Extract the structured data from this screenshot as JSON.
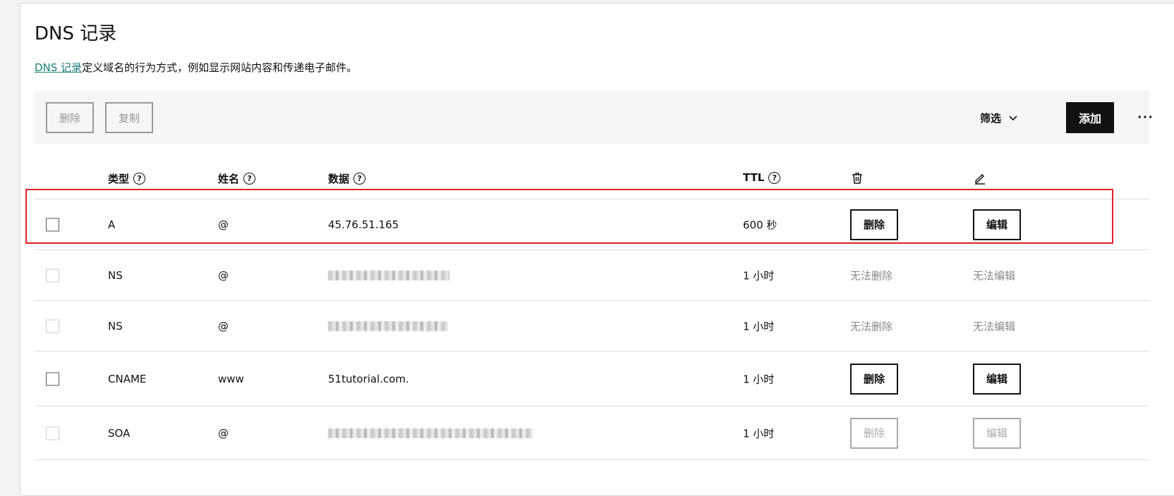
{
  "page": {
    "title": "DNS 记录",
    "description_link": "DNS 记录",
    "description_rest": "定义域名的行为方式，例如显示网站内容和传递电子邮件。"
  },
  "toolbar": {
    "delete_label": "删除",
    "copy_label": "复制",
    "filter_label": "筛选",
    "add_label": "添加",
    "more_label": "···"
  },
  "table": {
    "headers": {
      "type": "类型",
      "name": "姓名",
      "data": "数据",
      "ttl": "TTL"
    },
    "rows": [
      {
        "type": "A",
        "name": "@",
        "data": "45.76.51.165",
        "ttl": "600 秒",
        "delete": "删除",
        "edit": "编辑",
        "editable": true
      },
      {
        "type": "NS",
        "name": "@",
        "data": "",
        "ttl": "1 小时",
        "delete": "无法删除",
        "edit": "无法编辑",
        "editable": false
      },
      {
        "type": "NS",
        "name": "@",
        "data": "",
        "ttl": "1 小时",
        "delete": "无法删除",
        "edit": "无法编辑",
        "editable": false
      },
      {
        "type": "CNAME",
        "name": "www",
        "data": "51tutorial.com.",
        "ttl": "1 小时",
        "delete": "删除",
        "edit": "编辑",
        "editable": true
      },
      {
        "type": "SOA",
        "name": "@",
        "data": "",
        "ttl": "1 小时",
        "delete": "删除",
        "edit": "编辑",
        "editable": "disabled"
      }
    ]
  },
  "colors": {
    "accent_link": "#1a7f7a",
    "highlight": "#e3202a",
    "primary_button": "#111111"
  }
}
